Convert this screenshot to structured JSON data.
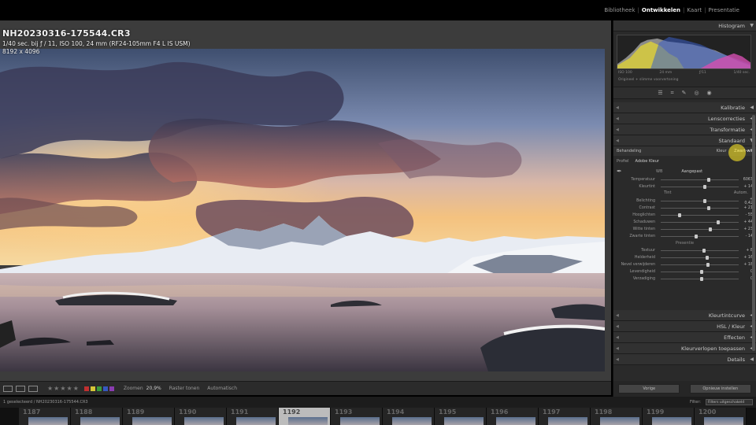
{
  "modules": [
    "Bibliotheek",
    "Ontwikkelen",
    "Kaart",
    "Presentatie"
  ],
  "active_module": "Ontwikkelen",
  "photo": {
    "filename": "NH20230316-175544.CR3",
    "exif": "1/40 sec. bij ƒ / 11, ISO 100, 24 mm (RF24-105mm F4 L IS USM)",
    "dimensions": "8192 x 4096"
  },
  "panels": {
    "histogram": "Histogram",
    "histogram_labels": [
      "ISO 100",
      "24 mm",
      "ƒ/11",
      "1/40 sec."
    ],
    "original_label": "Origineel + slimme voorvertoning",
    "calibration": "Kalibratie",
    "lens": "Lenscorrecties",
    "transform": "Transformatie",
    "basic": "Standaard",
    "tone_curve": "Kleurtintcurve",
    "hsl": "HSL / Kleur",
    "effects": "Effecten",
    "color_grading": "Kleurverlopen toepassen",
    "details": "Details"
  },
  "basic": {
    "treatment_label": "Behandeling",
    "treatment_options": [
      "Kleur",
      "Zwart-wit"
    ],
    "profile_label": "Profiel",
    "profile_value": "Adobe Kleur",
    "wb_label": "WB",
    "wb_value": "Aangepast",
    "temp": {
      "label": "Temperatuur",
      "value": "6067",
      "pos": 0.6
    },
    "tint": {
      "label": "Kleurtint",
      "value": "+ 14",
      "pos": 0.55
    },
    "tone_label": "Tint",
    "auto_label": "Autom.",
    "sliders": [
      {
        "label": "Belichting",
        "value": "+ 0,42",
        "pos": 0.55
      },
      {
        "label": "Contrast",
        "value": "+ 21",
        "pos": 0.6
      },
      {
        "label": "Hooglichten",
        "value": "- 55",
        "pos": 0.22
      },
      {
        "label": "Schaduwen",
        "value": "+ 44",
        "pos": 0.72
      },
      {
        "label": "Witte tinten",
        "value": "+ 23",
        "pos": 0.62
      },
      {
        "label": "Zwarte tinten",
        "value": "- 14",
        "pos": 0.43
      }
    ],
    "presence_label": "Presentie",
    "presence": [
      {
        "label": "Textuur",
        "value": "+ 8",
        "pos": 0.54
      },
      {
        "label": "Helderheid",
        "value": "+ 16",
        "pos": 0.58
      },
      {
        "label": "Nevel verwijderen",
        "value": "+ 18",
        "pos": 0.59
      },
      {
        "label": "Levendigheid",
        "value": "0",
        "pos": 0.5
      },
      {
        "label": "Verzadiging",
        "value": "0",
        "pos": 0.5
      }
    ]
  },
  "buttons": {
    "previous": "Vorige",
    "reset": "Opnieuw instellen"
  },
  "toolbar": {
    "zoom_label": "Zoomen",
    "zoom_value": "20,9%",
    "grid_label": "Raster tonen",
    "auto_label": "Automatisch"
  },
  "filmstrip": {
    "path": "1 geselecteerd / NH20230316-175544.CR3",
    "filter_label": "Filter:",
    "filter_value": "Filters uitgeschakeld",
    "numbers": [
      "1187",
      "1188",
      "1189",
      "1190",
      "1191",
      "1192",
      "1193",
      "1194",
      "1195",
      "1196",
      "1197",
      "1198",
      "1199",
      "1200"
    ],
    "selected": "1192"
  },
  "colors": {
    "sky_top": "#52698f",
    "horizon": "#f3c77d",
    "water": "#5b5160",
    "panel_bg": "#2a2a2a",
    "highlight": "#ebd728"
  }
}
